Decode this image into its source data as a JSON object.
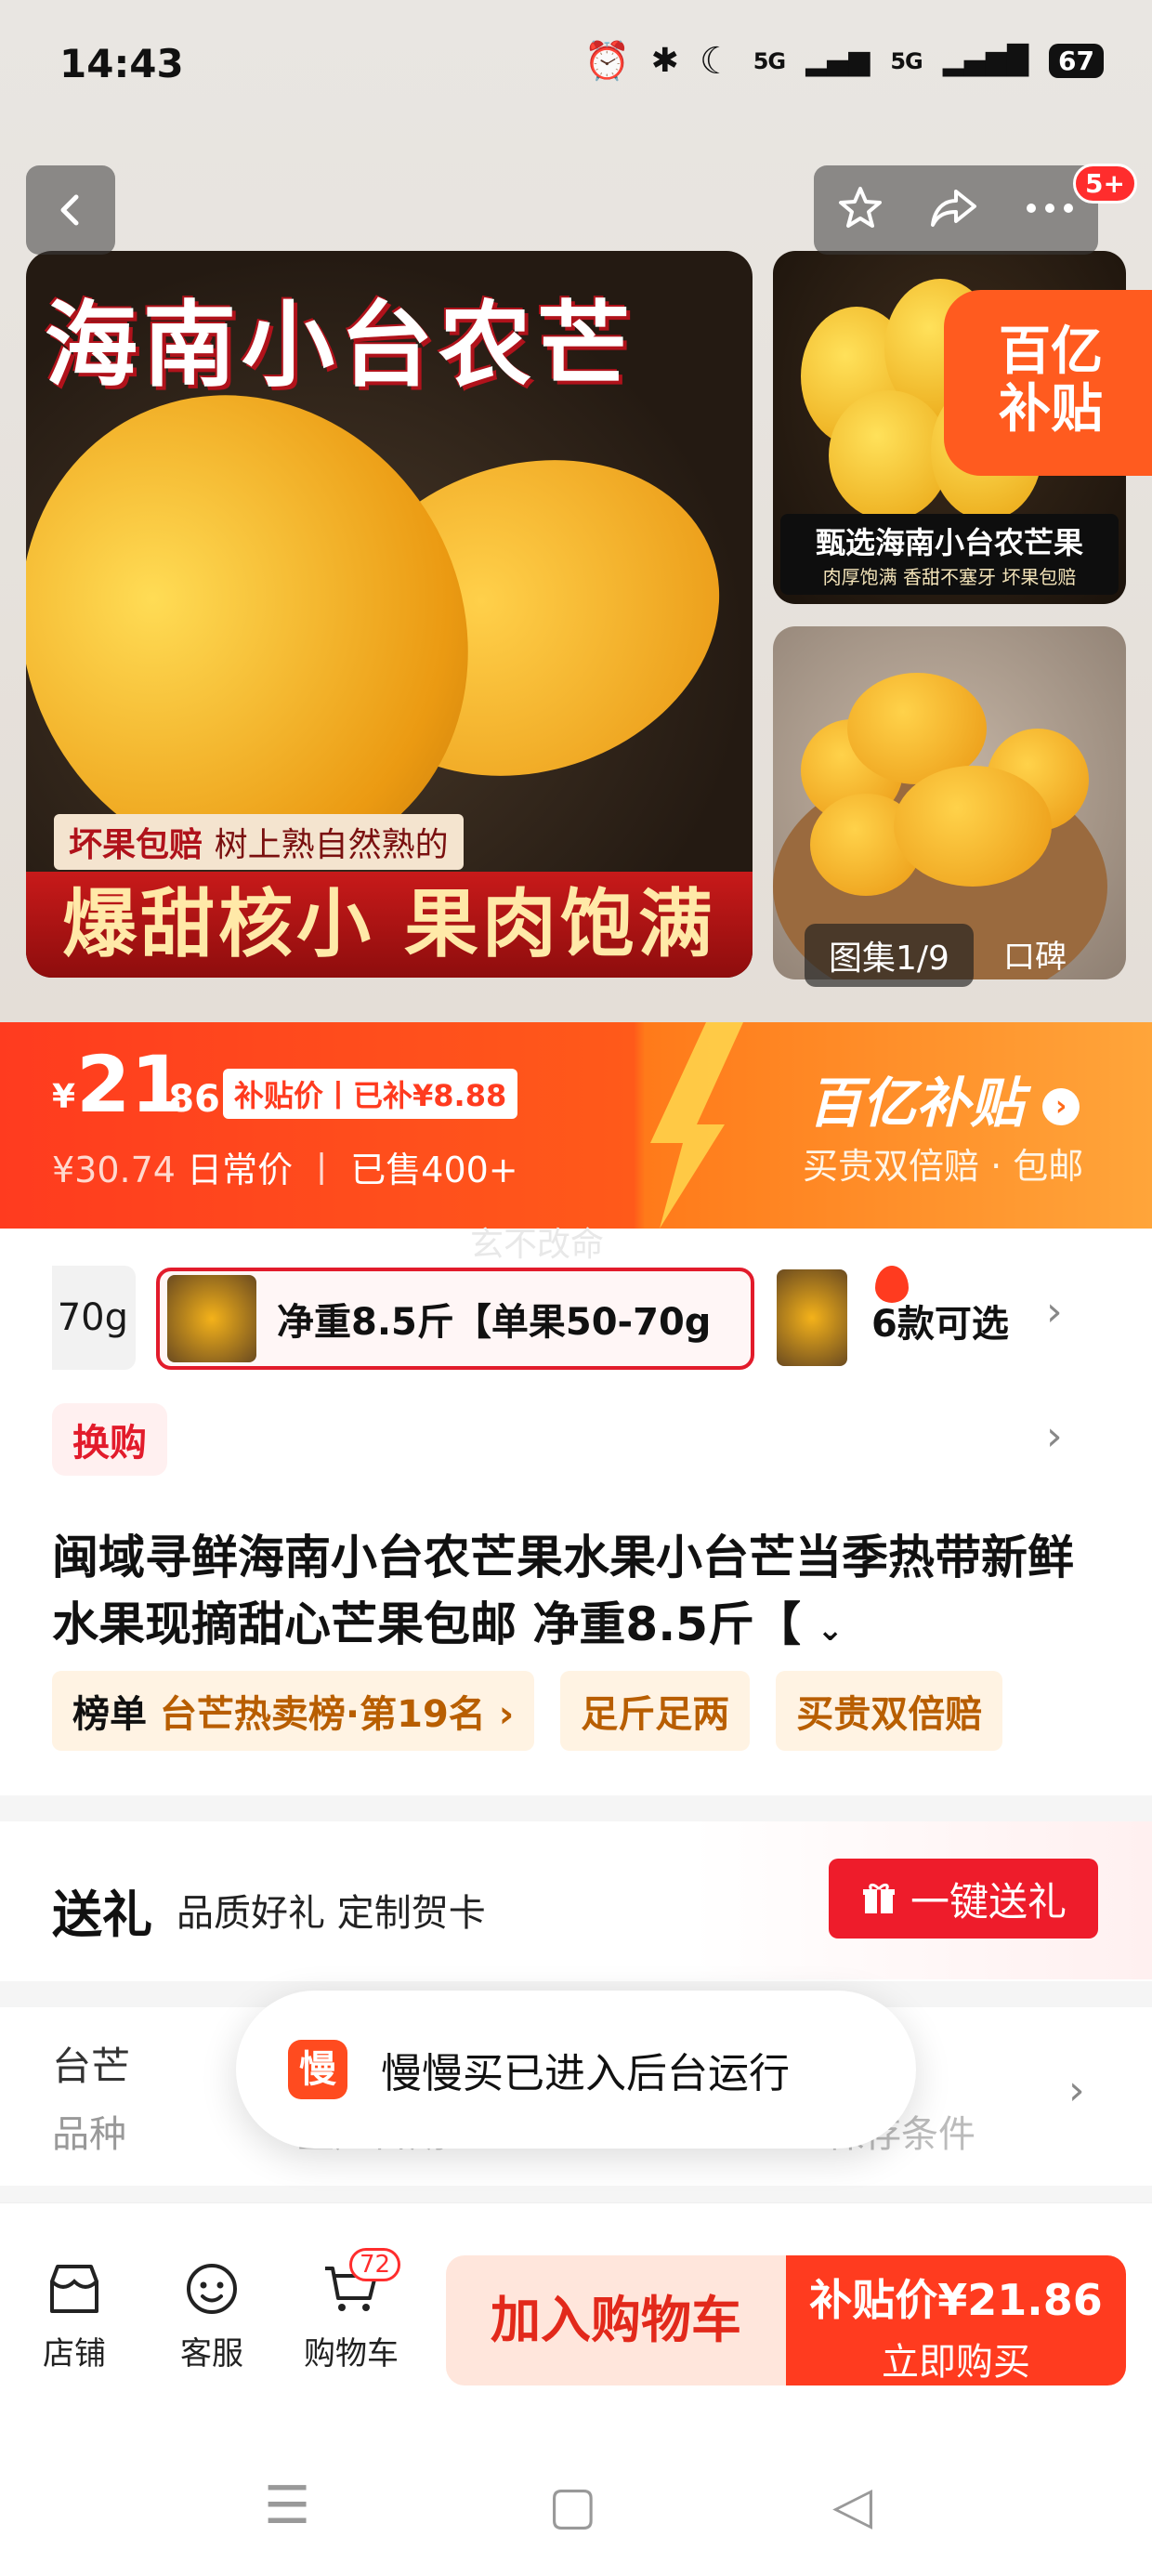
{
  "status_bar": {
    "time": "14:43",
    "signal1": "5G",
    "signal2": "5G",
    "battery": "67"
  },
  "nav": {
    "message_badge": "5+"
  },
  "gallery": {
    "main_title": "海南小台农芒",
    "main_tag_bold": "坏果包赔",
    "main_tag_rest": "树上熟自然熟的",
    "main_bottom": "爆甜核小 果肉饱满",
    "side1_caption": "甄选海南小台农芒果",
    "side1_sub": "肉厚饱满 香甜不塞牙 坏果包赔",
    "subsidy_badge_line1": "百亿",
    "subsidy_badge_line2": "补贴",
    "counter": "图集1/9",
    "counter_extra": "口碑"
  },
  "price": {
    "currency": "¥",
    "integer": "21",
    "decimal": ".86",
    "tag": "补贴价丨已补¥8.88",
    "original": "¥30.74",
    "original_label": "日常价",
    "sold": "已售400+",
    "program": "百亿补贴",
    "program_desc": "买贵双倍赔 · 包邮"
  },
  "watermark": "玄不改命",
  "sku": {
    "prev_label": "70g",
    "active_label": "净重8.5斤【单果50-70g",
    "more_label": "6款可选"
  },
  "swap_label": "换购",
  "product_title": "闽域寻鲜海南小台农芒果水果小台芒当季热带新鲜水果现摘甜心芒果包邮 净重8.5斤【",
  "tags": [
    {
      "prefix": "榜单",
      "text": "台芒热卖榜·第19名"
    },
    {
      "prefix": "",
      "text": "足斤足两"
    },
    {
      "prefix": "",
      "text": "买贵双倍赔"
    }
  ],
  "gift": {
    "title": "送礼",
    "desc": "品质好礼 定制贺卡",
    "button": "一键送礼"
  },
  "spec": {
    "key": "台芒",
    "value": "品种",
    "faded1": "生产日期",
    "faded2": "保存条件"
  },
  "toast": {
    "icon_char": "慢",
    "text": "慢慢买已进入后台运行"
  },
  "bottom_bar": {
    "store": "店铺",
    "service": "客服",
    "cart": "购物车",
    "cart_count": "72",
    "add_to_cart": "加入购物车",
    "buy_price": "补贴价¥21.86",
    "buy_label": "立即购买"
  },
  "colors": {
    "accent": "#ff3b1f",
    "gift_red": "#ee1c2b",
    "tag_bg": "#fff3e3"
  }
}
